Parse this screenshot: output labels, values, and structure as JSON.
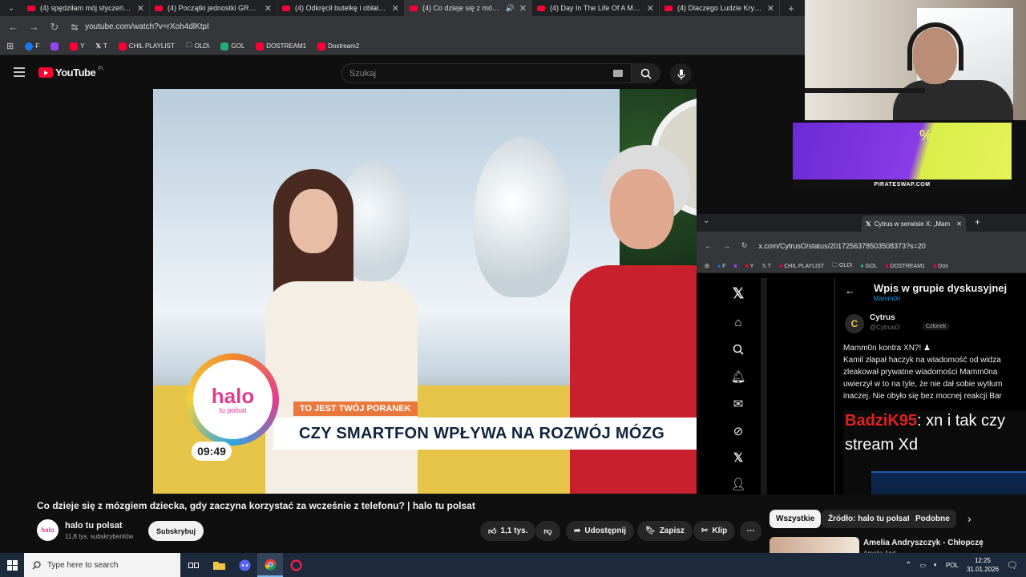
{
  "browser": {
    "tabs": [
      {
        "title": "(4) spędziłam mój styczeń w do",
        "active": false
      },
      {
        "title": "(4) Początki jednostki GROM. A",
        "active": false
      },
      {
        "title": "(4) Odkręcił butelkę i obłał ścia",
        "active": false
      },
      {
        "title": "(4) Co dzieje się z mózgiem",
        "active": true
      },
      {
        "title": "(4) Day In The Life Of A Multi-M",
        "active": false
      },
      {
        "title": "(4) Dlaczego Ludzie Krytykują Te",
        "active": false
      }
    ],
    "new_tab": "+",
    "url": "youtube.com/watch?v=rXoh4dlKtpI",
    "bookmarks": [
      {
        "label": "F",
        "color": "#1877f2"
      },
      {
        "label": "",
        "color": "#9146ff"
      },
      {
        "label": "Y",
        "color": "#ff0033"
      },
      {
        "label": "T",
        "color": "#000000"
      },
      {
        "label": "CHIL PLAYLIST",
        "color": "#ff0033"
      },
      {
        "label": "OLD\\",
        "color": "folder"
      },
      {
        "label": "GOL",
        "color": "#1fae7a"
      },
      {
        "label": "DOSTREAM1",
        "color": "#ff0033"
      },
      {
        "label": "Dostream2",
        "color": "#ff0033"
      }
    ]
  },
  "youtube": {
    "logo_text": "YouTube",
    "logo_region": "PL",
    "search_placeholder": "Szukaj",
    "video": {
      "show_tag": "TO JEST TWÓJ PORANEK",
      "ticker": "CZY SMARTFON WPŁYWA NA ROZWÓJ MÓZG",
      "halo_logo": "halo",
      "halo_sub": "tu polsat",
      "clock": "09:49"
    },
    "title": "Co dzieje się z mózgiem dziecka, gdy zaczyna korzystać za wcześnie z telefonu? | halo tu polsat",
    "channel": {
      "name": "halo tu polsat",
      "subscribers": "11,8 tys. subskrybentów",
      "avatar_text": "halo"
    },
    "subscribe_label": "Subskrybuj",
    "actions": {
      "likes": "1,1 tys.",
      "share": "Udostępnij",
      "save": "Zapisz",
      "clip": "Klip",
      "more": "⋯"
    },
    "chips": [
      {
        "label": "Wszystkie",
        "selected": true
      },
      {
        "label": "Źródło: halo tu polsat",
        "selected": false
      },
      {
        "label": "Podobne",
        "selected": false
      }
    ],
    "recommendation": {
      "title": "Amelia Andryszczyk - Chłopcze",
      "sub": "Amelia And..."
    }
  },
  "overlay": {
    "ad_caption": "PIRATESWAP.COM"
  },
  "x_window": {
    "tab_title": "Cytrus w serwisie X: „Mam",
    "url": "x.com/CytrusO/status/2017256378503508373?s=20",
    "bookmarks": [
      "F",
      "",
      "Y",
      "T",
      "CHIL PLAYLIST",
      "OLD\\",
      "GOL",
      "DOSTREAM1",
      "Dos"
    ],
    "heading": "Wpis w grupie dyskusyjnej",
    "group": "Mamm0n",
    "author": {
      "name": "Cytrus",
      "handle": "@CytrusO",
      "badge": "Członek",
      "avatar": "C"
    },
    "post_lines": [
      "Mamm0n kontra XN?! ♟",
      "Kamil złapał haczyk na wiadomość od widza",
      "zleakował prywatne wiadomości Mamm0na",
      "uwierzył w to na tyle, że nie dał sobie wytłum",
      "inaczej. Nie obyło się bez mocnej reakcji Bar"
    ],
    "quote_user": "BadziK95",
    "quote_rest": ": xn i tak czy",
    "quote_line2": "stream Xd"
  },
  "taskbar": {
    "search_placeholder": "Type here to search",
    "language": "POL",
    "time": "12:25",
    "date": "31.01.2026"
  }
}
